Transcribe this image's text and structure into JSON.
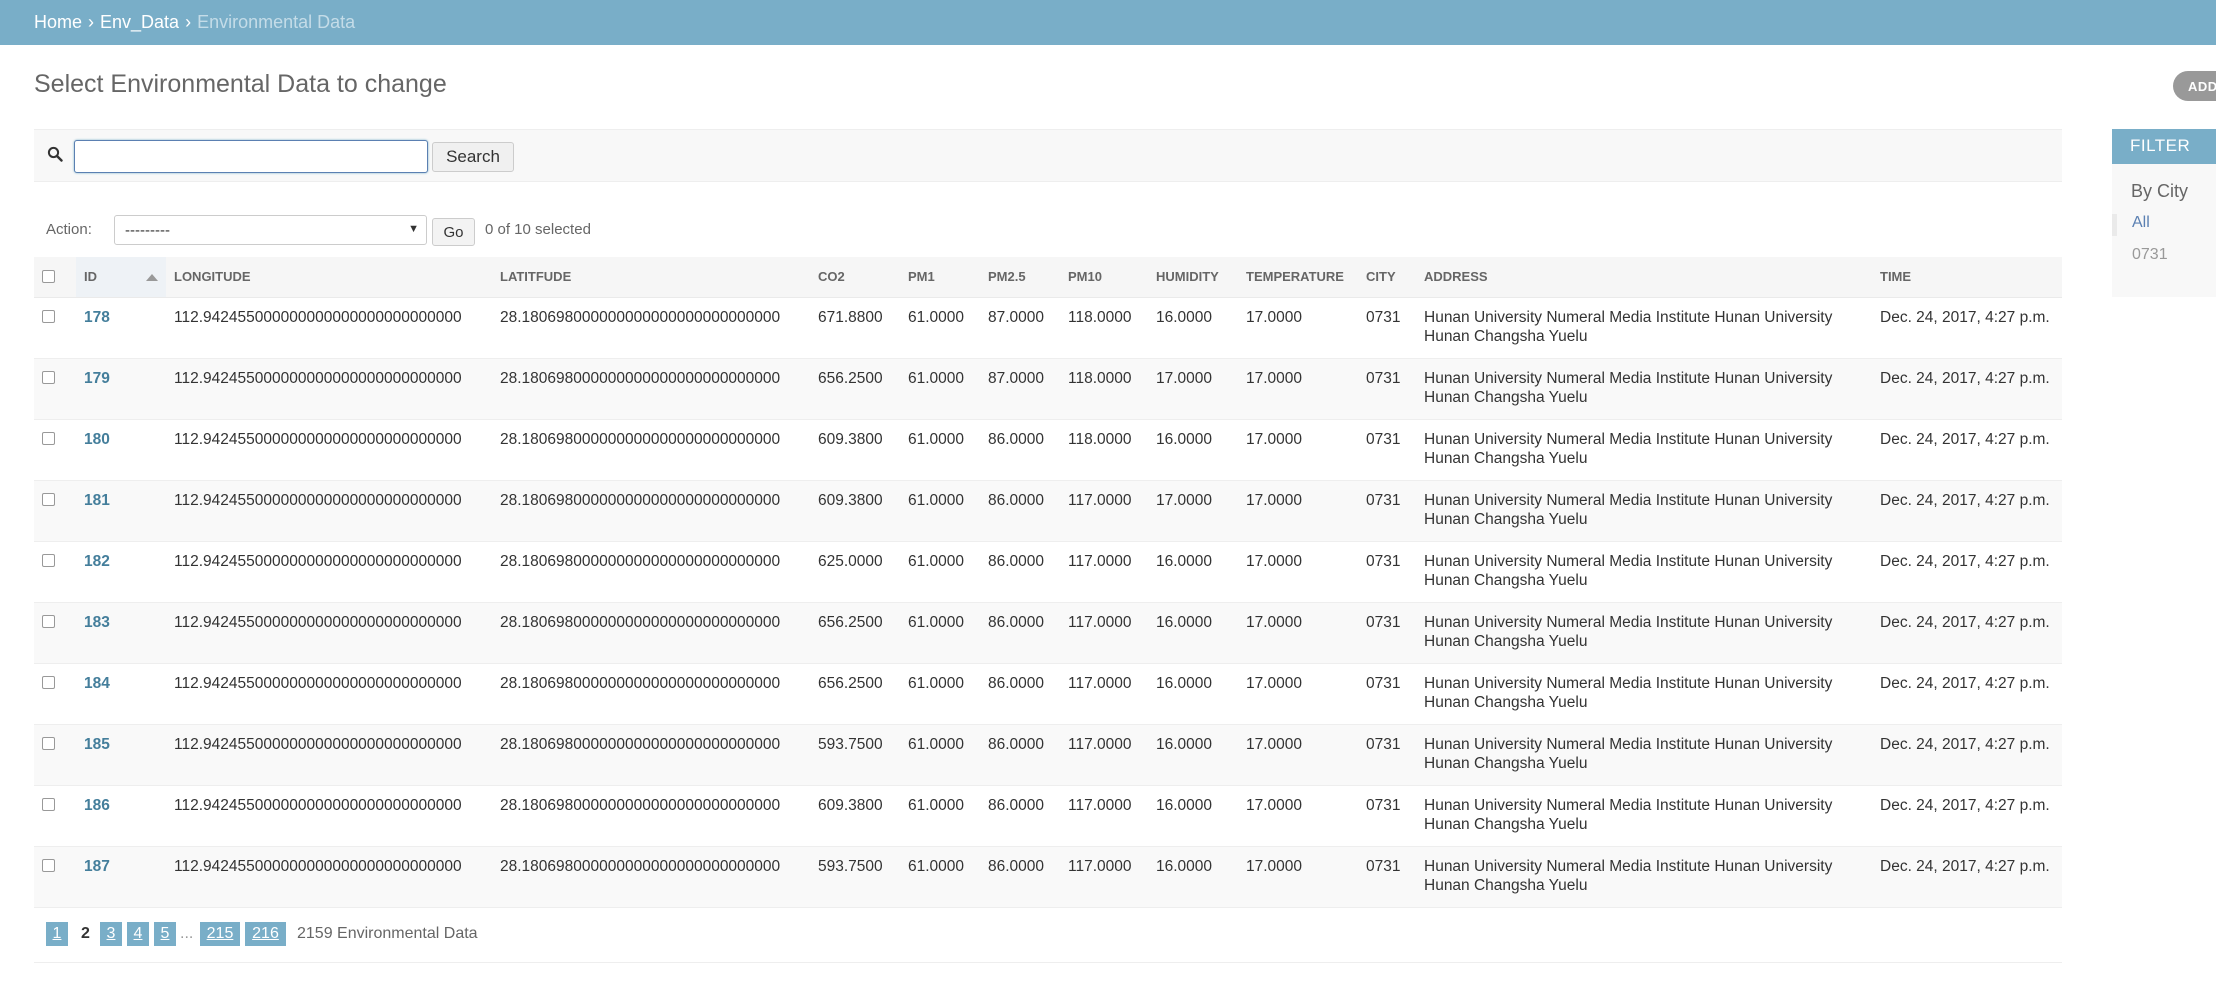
{
  "breadcrumb": {
    "home": "Home",
    "separator": "›",
    "app": "Env_Data",
    "current": "Environmental Data"
  },
  "page_title": "Select Environmental Data to change",
  "add_button": "ADD",
  "search": {
    "value": "",
    "button": "Search"
  },
  "actions": {
    "label": "Action:",
    "selected_option": "---------",
    "go": "Go",
    "counter": "0 of 10 selected"
  },
  "table": {
    "columns": [
      "ID",
      "LONGITUDE",
      "LATITFUDE",
      "CO2",
      "PM1",
      "PM2.5",
      "PM10",
      "HUMIDITY",
      "TEMPERATURE",
      "CITY",
      "ADDRESS",
      "TIME"
    ],
    "rows": [
      [
        "178",
        "112.942455000000000000000000000000",
        "28.180698000000000000000000000000",
        "671.8800",
        "61.0000",
        "87.0000",
        "118.0000",
        "16.0000",
        "17.0000",
        "0731",
        "Hunan University Numeral Media Institute Hunan University Hunan Changsha Yuelu",
        "Dec. 24, 2017, 4:27 p.m."
      ],
      [
        "179",
        "112.942455000000000000000000000000",
        "28.180698000000000000000000000000",
        "656.2500",
        "61.0000",
        "87.0000",
        "118.0000",
        "17.0000",
        "17.0000",
        "0731",
        "Hunan University Numeral Media Institute Hunan University Hunan Changsha Yuelu",
        "Dec. 24, 2017, 4:27 p.m."
      ],
      [
        "180",
        "112.942455000000000000000000000000",
        "28.180698000000000000000000000000",
        "609.3800",
        "61.0000",
        "86.0000",
        "118.0000",
        "16.0000",
        "17.0000",
        "0731",
        "Hunan University Numeral Media Institute Hunan University Hunan Changsha Yuelu",
        "Dec. 24, 2017, 4:27 p.m."
      ],
      [
        "181",
        "112.942455000000000000000000000000",
        "28.180698000000000000000000000000",
        "609.3800",
        "61.0000",
        "86.0000",
        "117.0000",
        "17.0000",
        "17.0000",
        "0731",
        "Hunan University Numeral Media Institute Hunan University Hunan Changsha Yuelu",
        "Dec. 24, 2017, 4:27 p.m."
      ],
      [
        "182",
        "112.942455000000000000000000000000",
        "28.180698000000000000000000000000",
        "625.0000",
        "61.0000",
        "86.0000",
        "117.0000",
        "16.0000",
        "17.0000",
        "0731",
        "Hunan University Numeral Media Institute Hunan University Hunan Changsha Yuelu",
        "Dec. 24, 2017, 4:27 p.m."
      ],
      [
        "183",
        "112.942455000000000000000000000000",
        "28.180698000000000000000000000000",
        "656.2500",
        "61.0000",
        "86.0000",
        "117.0000",
        "16.0000",
        "17.0000",
        "0731",
        "Hunan University Numeral Media Institute Hunan University Hunan Changsha Yuelu",
        "Dec. 24, 2017, 4:27 p.m."
      ],
      [
        "184",
        "112.942455000000000000000000000000",
        "28.180698000000000000000000000000",
        "656.2500",
        "61.0000",
        "86.0000",
        "117.0000",
        "16.0000",
        "17.0000",
        "0731",
        "Hunan University Numeral Media Institute Hunan University Hunan Changsha Yuelu",
        "Dec. 24, 2017, 4:27 p.m."
      ],
      [
        "185",
        "112.942455000000000000000000000000",
        "28.180698000000000000000000000000",
        "593.7500",
        "61.0000",
        "86.0000",
        "117.0000",
        "16.0000",
        "17.0000",
        "0731",
        "Hunan University Numeral Media Institute Hunan University Hunan Changsha Yuelu",
        "Dec. 24, 2017, 4:27 p.m."
      ],
      [
        "186",
        "112.942455000000000000000000000000",
        "28.180698000000000000000000000000",
        "609.3800",
        "61.0000",
        "86.0000",
        "117.0000",
        "16.0000",
        "17.0000",
        "0731",
        "Hunan University Numeral Media Institute Hunan University Hunan Changsha Yuelu",
        "Dec. 24, 2017, 4:27 p.m."
      ],
      [
        "187",
        "112.942455000000000000000000000000",
        "28.180698000000000000000000000000",
        "593.7500",
        "61.0000",
        "86.0000",
        "117.0000",
        "16.0000",
        "17.0000",
        "0731",
        "Hunan University Numeral Media Institute Hunan University Hunan Changsha Yuelu",
        "Dec. 24, 2017, 4:27 p.m."
      ]
    ]
  },
  "paginator": {
    "pages": [
      "1",
      "2",
      "3",
      "4",
      "5",
      "215",
      "216"
    ],
    "current": "2",
    "ellipsis": "...",
    "count": "2159 Environmental Data"
  },
  "filter": {
    "title": "FILTER",
    "heading": "By City",
    "options": [
      "All",
      "0731"
    ],
    "selected": "All"
  },
  "colors": {
    "header_bar": "#79aec8",
    "link": "#447e9b",
    "selected_filter": "#5b80b2"
  }
}
